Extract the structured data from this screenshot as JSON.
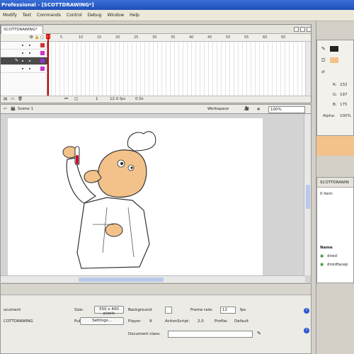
{
  "window": {
    "title": "Professional - [SCOTTDRAWING*]"
  },
  "menu": [
    "Modify",
    "Text",
    "Commands",
    "Control",
    "Debug",
    "Window",
    "Help"
  ],
  "timeline": {
    "doc_tab": "SCOTTDRAWING*",
    "frame_numbers": [
      "5",
      "10",
      "15",
      "20",
      "25",
      "30",
      "35",
      "40",
      "45",
      "50",
      "55",
      "60",
      "65"
    ],
    "status": {
      "frame": "1",
      "fps": "12.0 fps",
      "time": "0.0s"
    }
  },
  "editbar": {
    "scene": "Scene 1",
    "workspace": "Workspace",
    "zoom": "100%"
  },
  "properties": {
    "doc_type": "ocument",
    "doc_name": "COTTDRAWING",
    "size_label": "Size:",
    "size_value": "550 x 400 pixels",
    "background_label": "Background:",
    "framerate_label": "Frame rate:",
    "framerate_value": "12",
    "fps_unit": "fps",
    "publish_label": "Publish:",
    "settings_button": "Settings...",
    "player_label": "Player:",
    "player_value": "9",
    "actionscript_label": "ActionScript:",
    "actionscript_value": "2.0",
    "profile_label": "Profile:",
    "profile_value": "Default",
    "docclass_label": "Document class:"
  },
  "color_panel": {
    "r_label": "R:",
    "r_value": "232",
    "g_label": "G:",
    "g_value": "197",
    "b_label": "B:",
    "b_value": "175",
    "alpha_label": "Alpha:",
    "alpha_value": "100%"
  },
  "library": {
    "tab": "SCOTTDRAWIN",
    "items_label": "0 item",
    "name_header": "Name",
    "items": [
      "droid",
      "droidfacep"
    ]
  },
  "colors": {
    "swatch": "#f2c28a",
    "layer_swatches": [
      "#cc3333",
      "#cc33cc",
      "#9933cc",
      "#cc33cc"
    ]
  }
}
